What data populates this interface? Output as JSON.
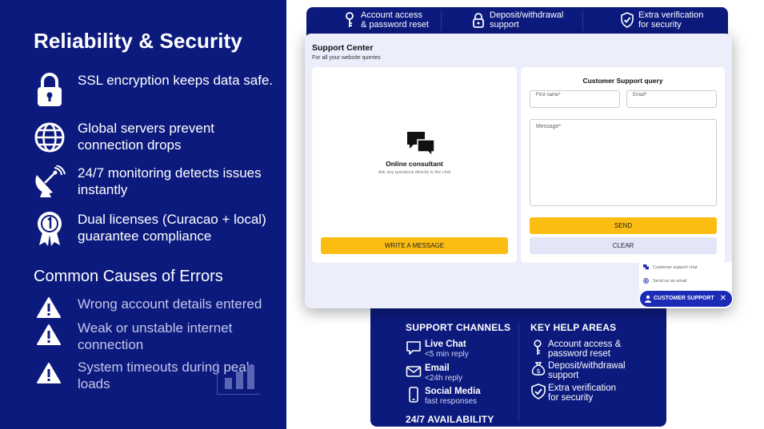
{
  "left": {
    "title": "Reliability & Security",
    "features": [
      {
        "icon": "padlock-icon",
        "text": "SSL encryption keeps data safe."
      },
      {
        "icon": "globe-icon",
        "text": "Global servers prevent connection drops"
      },
      {
        "icon": "satellite-dish-icon",
        "text": "24/7 monitoring detects issues instantly"
      },
      {
        "icon": "award-badge-icon",
        "text": "Dual licenses (Curacao + local) guarantee compliance"
      }
    ],
    "errors_title": "Common Causes of Errors",
    "errors": [
      {
        "icon": "warning-icon",
        "text": "Wrong account details entered"
      },
      {
        "icon": "warning-icon",
        "text": "Weak or unstable internet connection"
      },
      {
        "icon": "warning-icon",
        "text": "System timeouts during peak loads"
      }
    ],
    "colors": {
      "background": "#0c1a7e"
    }
  },
  "top_strip": {
    "items": [
      {
        "icon": "key-icon",
        "text1": "Account access",
        "text2": "& password reset"
      },
      {
        "icon": "lock-icon",
        "text1": "Deposit/withdrawal",
        "text2": "support"
      },
      {
        "icon": "shield-check-icon",
        "text1": "Extra verification",
        "text2": "for security"
      }
    ]
  },
  "support_window": {
    "title": "Support Center",
    "subtitle": "For all your website queries",
    "consultant": {
      "icon": "chat-bubbles-icon",
      "title": "Online consultant",
      "subtitle": "Ask any questions directly in the chat",
      "write_button": "WRITE A MESSAGE"
    },
    "form": {
      "title": "Customer Support query",
      "first_name_label": "First name*",
      "email_label": "Email*",
      "message_label": "Message*",
      "send_button": "SEND",
      "clear_button": "CLEAR"
    },
    "popup": {
      "items": [
        {
          "icon": "chat-icon",
          "text": "Customer support chat"
        },
        {
          "icon": "at-sign-icon",
          "text": "Send us an email"
        }
      ],
      "button_label": "CUSTOMER SUPPORT",
      "close": "✕"
    },
    "colors": {
      "accent": "#fbbd12",
      "brand": "#1b2bb5"
    }
  },
  "bottom_panel": {
    "channels_title": "SUPPORT CHANNELS",
    "channels": [
      {
        "icon": "chat-icon",
        "name": "Live Chat",
        "detail": "<5 min reply"
      },
      {
        "icon": "mail-icon",
        "name": "Email",
        "detail": "<24h reply"
      },
      {
        "icon": "phone-icon",
        "name": "Social Media",
        "detail": "fast responses"
      }
    ],
    "availability": "24/7 AVAILABILITY",
    "help_title": "KEY HELP AREAS",
    "help_areas": [
      {
        "icon": "key-icon",
        "text1": "Account access &",
        "text2": "password reset"
      },
      {
        "icon": "money-bag-icon",
        "text1": "Deposit/withdrawal",
        "text2": "support"
      },
      {
        "icon": "shield-check-icon",
        "text1": "Extra verification",
        "text2": "for security"
      }
    ]
  }
}
